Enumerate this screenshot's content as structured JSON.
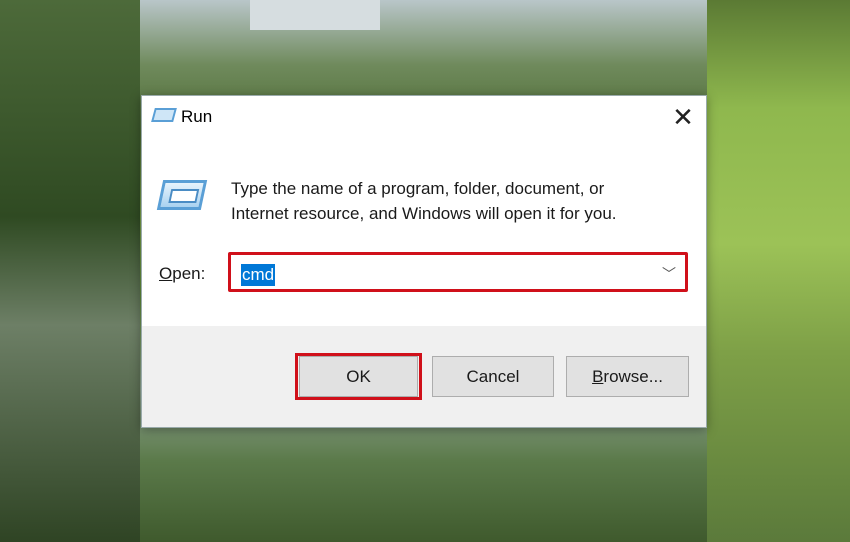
{
  "dialog": {
    "title": "Run",
    "description_line1": "Type the name of a program, folder, document, or",
    "description_line2": "Internet resource, and Windows will open it for you.",
    "open_label_accel": "O",
    "open_label_rest": "pen:",
    "open_value": "cmd",
    "buttons": {
      "ok": "OK",
      "cancel": "Cancel",
      "browse_accel": "B",
      "browse_rest": "rowse..."
    }
  },
  "colors": {
    "highlight": "#d0101a",
    "selection": "#0078d7"
  }
}
